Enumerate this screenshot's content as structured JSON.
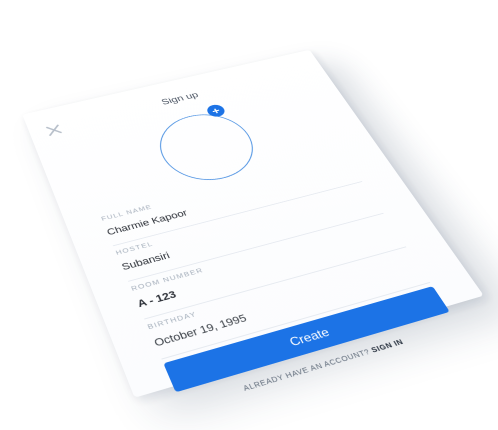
{
  "header": {
    "title": "Sign up"
  },
  "avatar": {
    "add_icon": "+"
  },
  "form": {
    "full_name": {
      "label": "FULL NAME",
      "value": "Charmie Kapoor"
    },
    "hostel": {
      "label": "HOSTEL",
      "value": "Subansiri"
    },
    "room": {
      "label": "ROOM NUMBER",
      "value": "A - 123"
    },
    "birthday": {
      "label": "BIRTHDAY",
      "value": "October 19, 1995"
    }
  },
  "actions": {
    "create_label": "Create"
  },
  "footer": {
    "question": "ALREADY HAVE AN ACCOUNT?",
    "signin_label": "SIGN IN"
  },
  "colors": {
    "accent": "#1c73e6",
    "avatar_ring": "#4a90e2"
  }
}
